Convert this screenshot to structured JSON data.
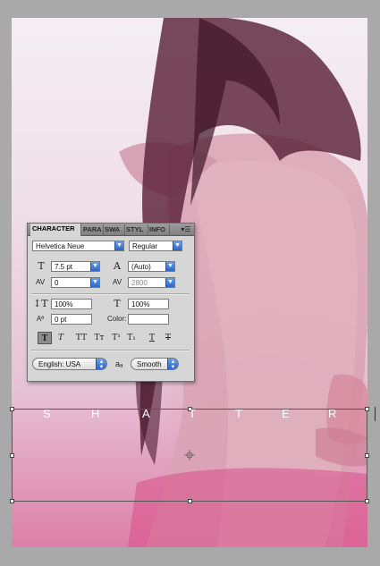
{
  "panel": {
    "tabs": [
      "CHARACTER",
      "PARA",
      "SWA",
      "STYL",
      "INFO"
    ],
    "menu_icon": "panel-menu-icon",
    "font_family": "Helvetica Neue",
    "font_style": "Regular",
    "font_size": "7.5 pt",
    "leading": "(Auto)",
    "kerning": "0",
    "tracking": "2800",
    "vertical_scale": "100%",
    "horizontal_scale": "100%",
    "baseline_shift": "0 pt",
    "color_label": "Color:",
    "style_buttons": [
      "T",
      "T",
      "TT",
      "Tт",
      "T¹",
      "T₁",
      "T",
      "T"
    ],
    "language": "English: USA",
    "antialias_icon": "aₐ",
    "antialias": "Smooth"
  },
  "canvas": {
    "text_letters": [
      "S",
      "H",
      "A",
      "T",
      "T",
      "E",
      "R"
    ]
  },
  "colors": {
    "panel_bg": "#d6d6d6",
    "accent_blue": "#2a64c8",
    "canvas_bg": "#a9a9a9"
  }
}
